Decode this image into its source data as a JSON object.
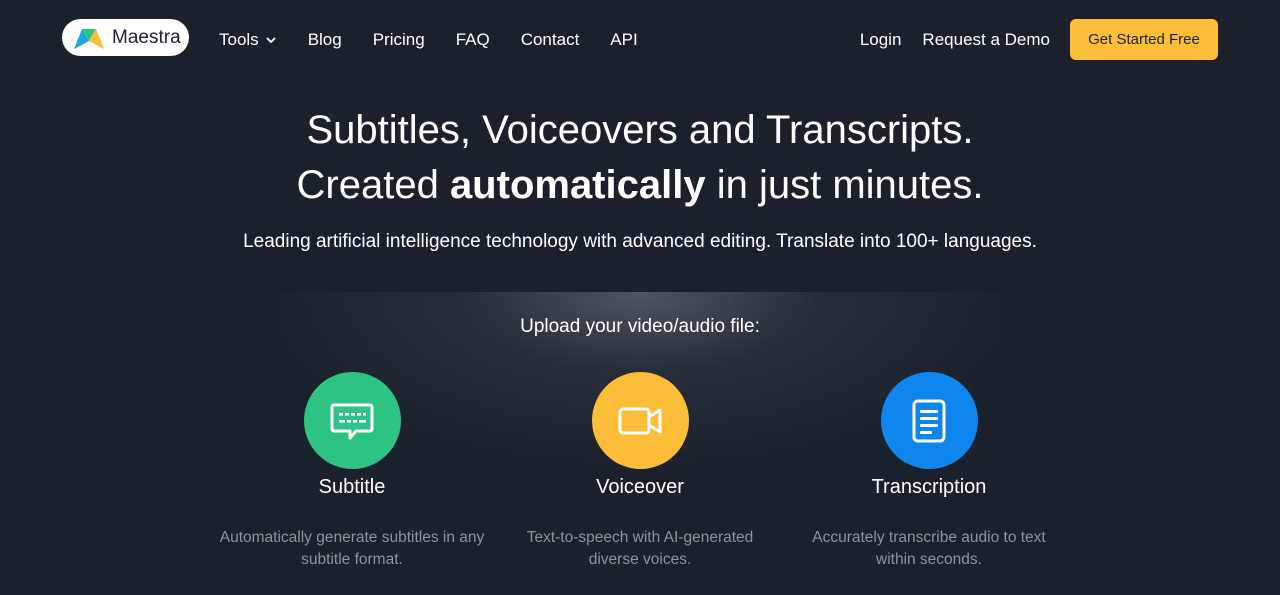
{
  "brand": {
    "name": "Maestra"
  },
  "nav": {
    "links": [
      {
        "label": "Tools",
        "has_dropdown": true
      },
      {
        "label": "Blog"
      },
      {
        "label": "Pricing"
      },
      {
        "label": "FAQ"
      },
      {
        "label": "Contact"
      },
      {
        "label": "API"
      }
    ],
    "login": "Login",
    "request_demo": "Request a Demo",
    "cta": "Get Started Free"
  },
  "hero": {
    "line1": "Subtitles, Voiceovers and Transcripts.",
    "line2_pre": "Created ",
    "line2_bold": "automatically",
    "line2_post": " in just minutes.",
    "subtitle": "Leading artificial intelligence technology with advanced editing. Translate into 100+ languages."
  },
  "upload": {
    "label": "Upload your video/audio file:",
    "options": [
      {
        "title": "Subtitle",
        "description": "Automatically generate subtitles in any subtitle format.",
        "icon": "subtitle-chat-icon",
        "color": "#2dc383"
      },
      {
        "title": "Voiceover",
        "description": "Text-to-speech with AI-generated diverse voices.",
        "icon": "video-camera-icon",
        "color": "#fcbd38"
      },
      {
        "title": "Transcription",
        "description": "Accurately transcribe audio to text within seconds.",
        "icon": "document-icon",
        "color": "#0f86ee"
      }
    ]
  },
  "colors": {
    "background": "#1b212c",
    "accent": "#fcbd38",
    "muted_text": "#8a93a3"
  }
}
